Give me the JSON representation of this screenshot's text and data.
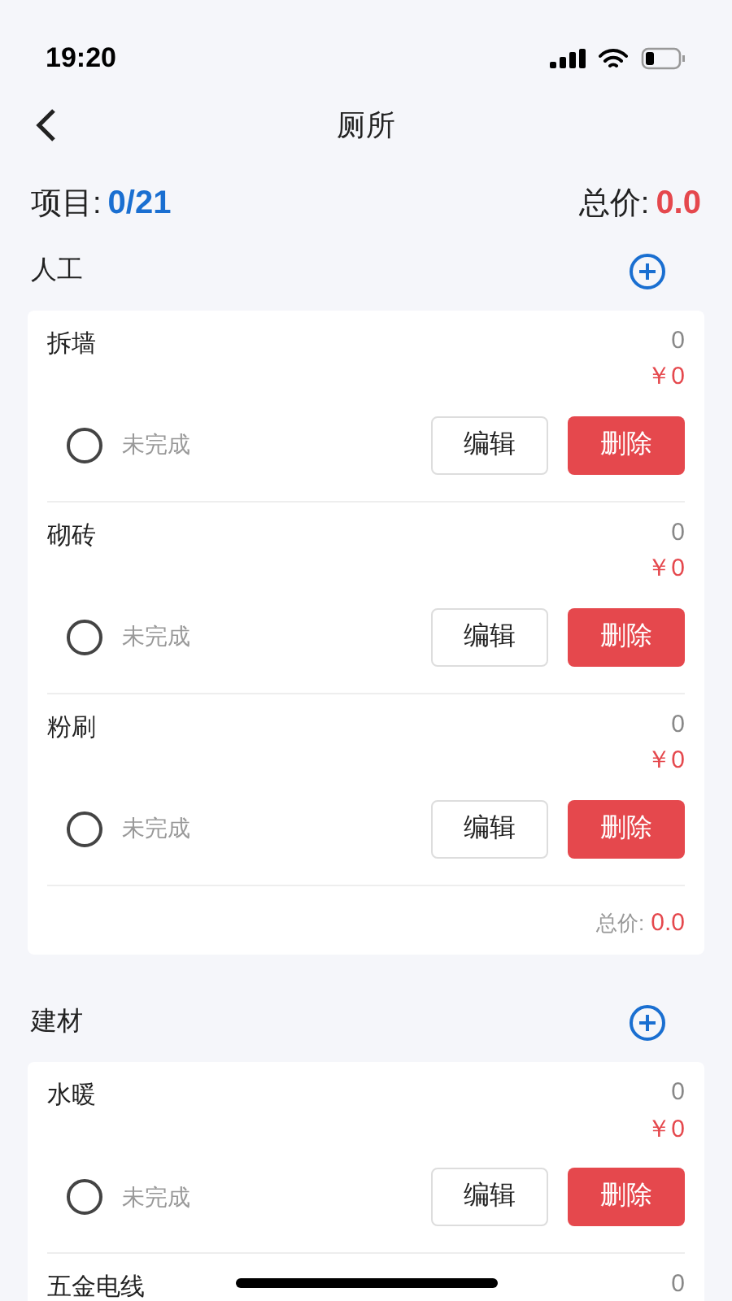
{
  "status_bar": {
    "time": "19:20"
  },
  "nav": {
    "title": "厕所"
  },
  "summary": {
    "items_label": "项目:",
    "items_value": "0/21",
    "total_label": "总价:",
    "total_value": "0.0"
  },
  "sections": [
    {
      "title": "人工",
      "items": [
        {
          "name": "拆墙",
          "quantity": "0",
          "price": "￥0",
          "done": false,
          "status": "未完成",
          "edit": "编辑",
          "delete": "删除"
        },
        {
          "name": "砌砖",
          "quantity": "0",
          "price": "￥0",
          "done": false,
          "status": "未完成",
          "edit": "编辑",
          "delete": "删除"
        },
        {
          "name": "粉刷",
          "quantity": "0",
          "price": "￥0",
          "done": false,
          "status": "未完成",
          "edit": "编辑",
          "delete": "删除"
        }
      ],
      "footer": {
        "label": "总价:",
        "value": "0.0"
      }
    },
    {
      "title": "建材",
      "items": [
        {
          "name": "水暖",
          "quantity": "0",
          "price": "￥0",
          "done": false,
          "status": "未完成",
          "edit": "编辑",
          "delete": "删除"
        },
        {
          "name": "五金电线",
          "quantity": "0"
        }
      ]
    }
  ]
}
